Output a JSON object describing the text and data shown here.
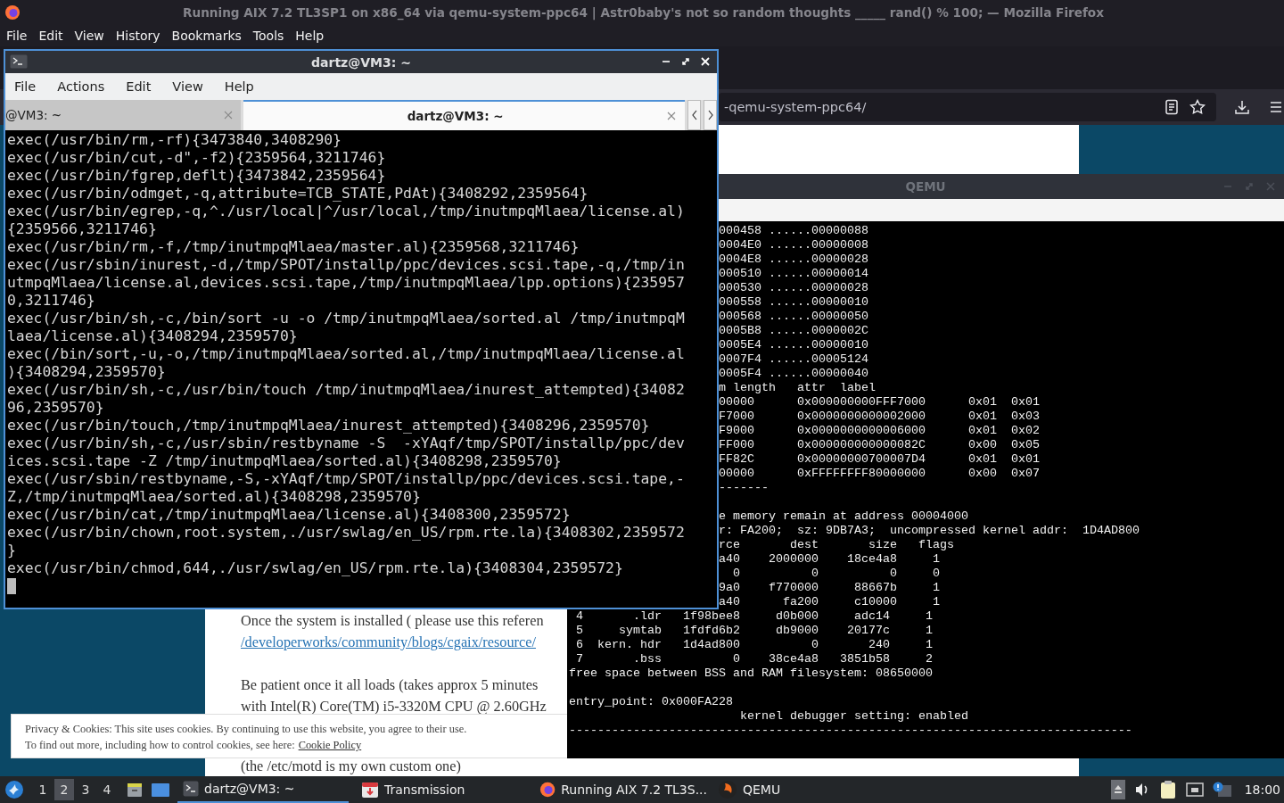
{
  "browser": {
    "title": "Running AIX 7.2 TL3SP1 on x86_64 via qemu-system-ppc64 | Astr0baby's not so random thoughts _____ rand() % 100; — Mozilla Firefox",
    "menu": [
      "File",
      "Edit",
      "View",
      "History",
      "Bookmarks",
      "Tools",
      "Help"
    ],
    "url": "-qemu-system-ppc64/"
  },
  "article": {
    "paragraphs": [
      [
        {
          "kind": "text",
          "text": "Once the system is installed ( please use this referen"
        },
        {
          "kind": "link",
          "text": "/developerworks/community/blogs/cgaix/resource/"
        }
      ],
      [
        {
          "kind": "text",
          "text": "Be patient once it all loads (takes approx 5 minutes"
        },
        {
          "kind": "text",
          "text": "with Intel(R) Core(TM) i5-3320M CPU @ 2.60GHz"
        }
      ],
      [
        {
          "kind": "text",
          "text": "(the /etc/motd is my own custom one)"
        }
      ]
    ]
  },
  "cookie_banner": {
    "line_1": "Privacy & Cookies: This site uses cookies. By continuing to use this website, you agree to their use.",
    "line_2": "To find out more, including how to control cookies, see here:",
    "link": "Cookie Policy"
  },
  "terminal": {
    "title": "dartz@VM3: ~",
    "menu": [
      "File",
      "Actions",
      "Edit",
      "View",
      "Help"
    ],
    "tabs": [
      {
        "label": "@VM3: ~",
        "selected": false
      },
      {
        "label": "dartz@VM3: ~",
        "selected": true
      }
    ],
    "lines": [
      "exec(/usr/bin/rm,-rf){3473840,3408290}",
      "exec(/usr/bin/cut,-d\",-f2){2359564,3211746}",
      "exec(/usr/bin/fgrep,deflt){3473842,2359564}",
      "exec(/usr/bin/odmget,-q,attribute=TCB_STATE,PdAt){3408292,2359564}",
      "exec(/usr/bin/egrep,-q,^./usr/local|^/usr/local,/tmp/inutmpqMlaea/license.al)",
      "{2359566,3211746}",
      "exec(/usr/bin/rm,-f,/tmp/inutmpqMlaea/master.al){2359568,3211746}",
      "exec(/usr/sbin/inurest,-d,/tmp/SPOT/installp/ppc/devices.scsi.tape,-q,/tmp/in",
      "utmpqMlaea/license.al,devices.scsi.tape,/tmp/inutmpqMlaea/lpp.options){235957",
      "0,3211746}",
      "exec(/usr/bin/sh,-c,/bin/sort -u -o /tmp/inutmpqMlaea/sorted.al /tmp/inutmpqM",
      "laea/license.al){3408294,2359570}",
      "exec(/bin/sort,-u,-o,/tmp/inutmpqMlaea/sorted.al,/tmp/inutmpqMlaea/license.al",
      "){3408294,2359570}",
      "exec(/usr/bin/sh,-c,/usr/bin/touch /tmp/inutmpqMlaea/inurest_attempted){34082",
      "96,2359570}",
      "exec(/usr/bin/touch,/tmp/inutmpqMlaea/inurest_attempted){3408296,2359570}",
      "exec(/usr/bin/sh,-c,/usr/sbin/restbyname -S  -xYAqf/tmp/SPOT/installp/ppc/dev",
      "ices.scsi.tape -Z /tmp/inutmpqMlaea/sorted.al){3408298,2359570}",
      "exec(/usr/sbin/restbyname,-S,-xYAqf/tmp/SPOT/installp/ppc/devices.scsi.tape,-",
      "Z,/tmp/inutmpqMlaea/sorted.al){3408298,2359570}",
      "exec(/usr/bin/cat,/tmp/inutmpqMlaea/license.al){3408300,2359572}",
      "exec(/usr/bin/chown,root.system,./usr/swlag/en_US/rpm.rte.la){3408302,2359572",
      "}",
      "exec(/usr/bin/chmod,644,./usr/swlag/en_US/rpm.rte.la){3408304,2359572}"
    ]
  },
  "qemu": {
    "title": "QEMU",
    "upper": [
      [
        "000458 ......00000088",
        "0004E0 ......00000008",
        "0004E8 ......00000028",
        "000510 ......00000014",
        "000530 ......00000028",
        "000558 ......00000010",
        "000568 ......00000050",
        "0005B8 ......0000002C",
        "0005E4 ......00000010",
        "0007F4 ......00005124",
        "0005F4 ......00000040",
        "m length   attr  label",
        "00000      0x000000000FFF7000      0x01  0x01",
        "F7000      0x0000000000002000      0x01  0x03",
        "F9000      0x0000000000006000      0x01  0x02",
        "FF000      0x000000000000082C      0x00  0x05",
        "FF82C      0x00000000700007D4      0x01  0x01",
        "00000      0xFFFFFFFF80000000      0x00  0x07",
        "-------"
      ],
      [
        "e memory remain at address 00004000",
        "r: FA200;  sz: 9DB7A3;  uncompressed kernel addr:  1D4AD800",
        "rce       dest       size   flags",
        "a40    2000000    18ce4a8     1",
        "  0          0          0     0",
        "9a0    f770000     88667b     1",
        "a40      fa200     c10000     1"
      ]
    ],
    "lower": [
      [
        " 4       .ldr   1f98bee8     d0b000     adc14     1",
        " 5     symtab   1fdfd6b2     db9000    20177c     1",
        " 6  kern. hdr   1d4ad800          0       240     1",
        " 7       .bss          0    38ce4a8   3851b58     2",
        "free space between BSS and RAM filesystem: 08650000"
      ],
      [
        "entry_point: 0x000FA228",
        "                        kernel debugger setting: enabled",
        "-------------------------------------------------------------------------------"
      ]
    ]
  },
  "taskbar": {
    "workspaces": [
      {
        "label": "1",
        "selected": false
      },
      {
        "label": "2",
        "selected": true
      },
      {
        "label": "3",
        "selected": false
      },
      {
        "label": "4",
        "selected": false
      }
    ],
    "tasks": [
      {
        "label": "dartz@VM3: ~",
        "kind": "terminal",
        "selected": true
      },
      {
        "label": "Transmission",
        "kind": "transmission",
        "selected": false
      },
      {
        "label": "Running AIX 7.2 TL3S...",
        "kind": "firefox",
        "selected": false
      },
      {
        "label": "QEMU",
        "kind": "qemu",
        "selected": false
      }
    ],
    "clock": "18:00"
  }
}
